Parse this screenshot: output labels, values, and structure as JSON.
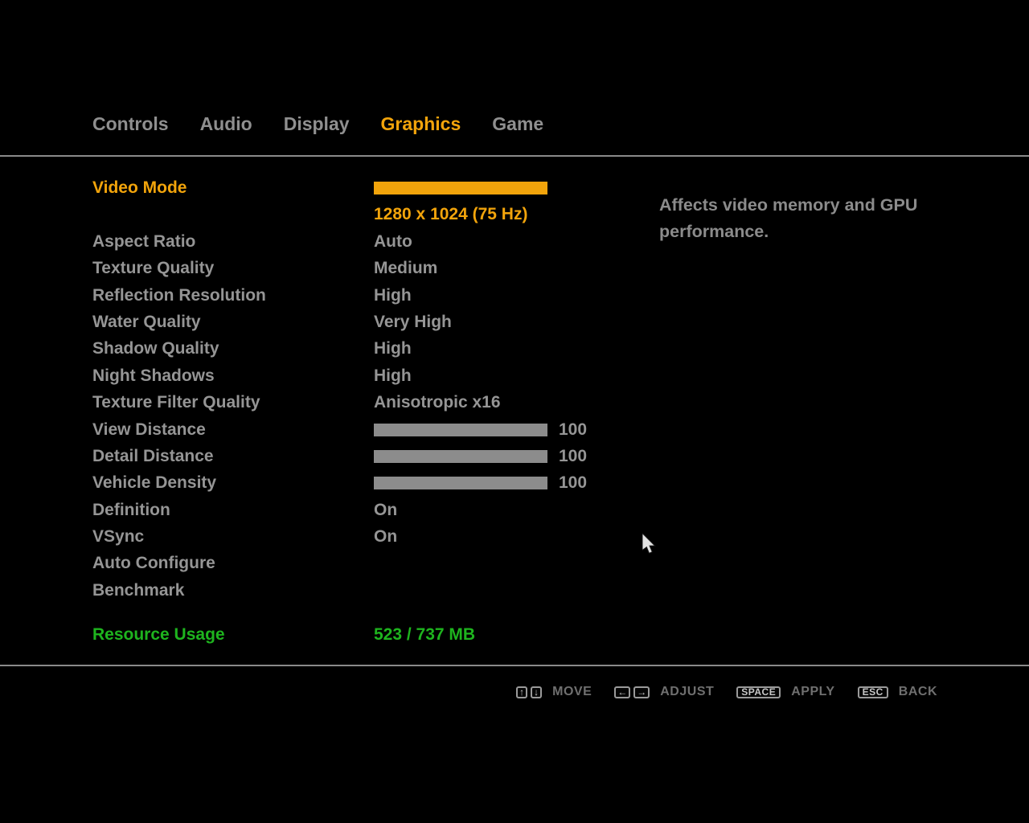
{
  "colors": {
    "accent": "#F2A40B",
    "green": "#1EB41E",
    "slider": "#8C8C8C"
  },
  "tabs": [
    {
      "label": "Controls",
      "active": false
    },
    {
      "label": "Audio",
      "active": false
    },
    {
      "label": "Display",
      "active": false
    },
    {
      "label": "Graphics",
      "active": true
    },
    {
      "label": "Game",
      "active": false
    }
  ],
  "settings": {
    "rows": [
      {
        "label": "Video Mode",
        "type": "resolution",
        "value": "1280 x 1024 (75 Hz)",
        "selected": true
      },
      {
        "label": "Aspect Ratio",
        "type": "text",
        "value": "Auto",
        "selected": false
      },
      {
        "label": "Texture Quality",
        "type": "text",
        "value": "Medium",
        "selected": false
      },
      {
        "label": "Reflection Resolution",
        "type": "text",
        "value": "High",
        "selected": false
      },
      {
        "label": "Water Quality",
        "type": "text",
        "value": "Very High",
        "selected": false
      },
      {
        "label": "Shadow Quality",
        "type": "text",
        "value": "High",
        "selected": false
      },
      {
        "label": "Night Shadows",
        "type": "text",
        "value": "High",
        "selected": false
      },
      {
        "label": "Texture Filter Quality",
        "type": "text",
        "value": "Anisotropic x16",
        "selected": false
      },
      {
        "label": "View Distance",
        "type": "slider",
        "value": "100",
        "percent": 100,
        "selected": false
      },
      {
        "label": "Detail Distance",
        "type": "slider",
        "value": "100",
        "percent": 100,
        "selected": false
      },
      {
        "label": "Vehicle Density",
        "type": "slider",
        "value": "100",
        "percent": 100,
        "selected": false
      },
      {
        "label": "Definition",
        "type": "text",
        "value": "On",
        "selected": false
      },
      {
        "label": "VSync",
        "type": "text",
        "value": "On",
        "selected": false
      },
      {
        "label": "Auto Configure",
        "type": "action",
        "selected": false
      },
      {
        "label": "Benchmark",
        "type": "action",
        "selected": false
      }
    ]
  },
  "description": {
    "text": "Affects video memory and GPU performance."
  },
  "resource": {
    "label": "Resource Usage",
    "value": "523 / 737 MB"
  },
  "hints": [
    {
      "keys": [
        "↑",
        "↓"
      ],
      "label": "MOVE"
    },
    {
      "keys": [
        "←",
        "→"
      ],
      "label": "ADJUST"
    },
    {
      "keys": [
        "SPACE"
      ],
      "label": "APPLY"
    },
    {
      "keys": [
        "ESC"
      ],
      "label": "BACK"
    }
  ]
}
